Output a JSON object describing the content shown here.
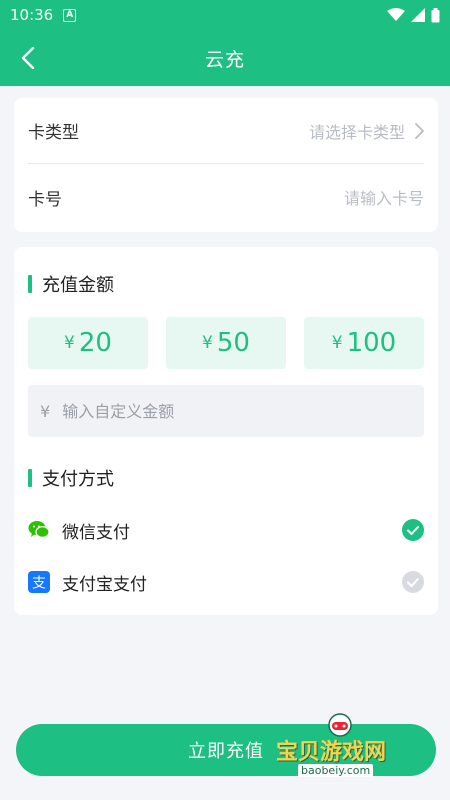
{
  "status_bar": {
    "time": "10:36",
    "notification_icon": "a-icon"
  },
  "nav": {
    "title": "云充"
  },
  "card": {
    "type_label": "卡类型",
    "type_placeholder": "请选择卡类型",
    "number_label": "卡号",
    "number_placeholder": "请输入卡号"
  },
  "recharge": {
    "section_title": "充值金额",
    "currency_symbol": "¥",
    "amounts": [
      "20",
      "50",
      "100"
    ],
    "custom_placeholder": "输入自定义金额"
  },
  "payment": {
    "section_title": "支付方式",
    "methods": [
      {
        "label": "微信支付",
        "icon": "wechat-icon",
        "selected": true
      },
      {
        "label": "支付宝支付",
        "icon": "alipay-icon",
        "selected": false
      }
    ]
  },
  "submit": {
    "label": "立即充值"
  },
  "watermark": {
    "text": "宝贝游戏网",
    "url": "baobeiy.com"
  },
  "colors": {
    "accent": "#1dbf83",
    "accent_light": "#e6f8f1",
    "background": "#f3f5f8"
  }
}
